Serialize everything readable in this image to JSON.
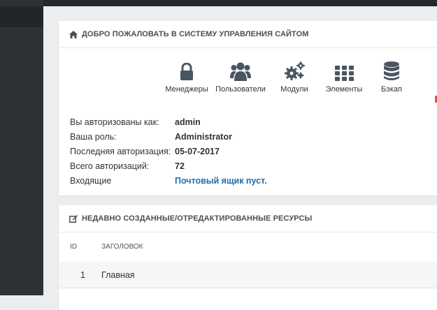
{
  "welcome_panel": {
    "title": "Добро пожаловать в систему управления сайтом",
    "buttons": [
      {
        "label": "Менеджеры",
        "icon": "lock-icon"
      },
      {
        "label": "Пользователи",
        "icon": "users-icon"
      },
      {
        "label": "Модули",
        "icon": "cogs-icon"
      },
      {
        "label": "Элементы",
        "icon": "grid-icon"
      },
      {
        "label": "Бэкап",
        "icon": "database-icon"
      }
    ],
    "info": [
      {
        "label": "Вы авторизованы как:",
        "value": "admin"
      },
      {
        "label": "Ваша роль:",
        "value": "Administrator"
      },
      {
        "label": "Последняя авторизация:",
        "value": "05-07-2017"
      },
      {
        "label": "Всего авторизаций:",
        "value": "72"
      },
      {
        "label": "Входящие",
        "value": "Почтовый ящик пуст."
      }
    ]
  },
  "recent_panel": {
    "title": "Недавно созданные/отредактированные ресурсы",
    "columns": [
      "ID",
      "Заголовок"
    ],
    "rows": [
      {
        "id": "1",
        "title": "Главная"
      }
    ]
  },
  "colors": {
    "sidebar": "#2e3136",
    "topbar": "#25282c",
    "link": "#1f6fa8",
    "icon": "#4a5563",
    "accent_red": "#d9534f"
  }
}
